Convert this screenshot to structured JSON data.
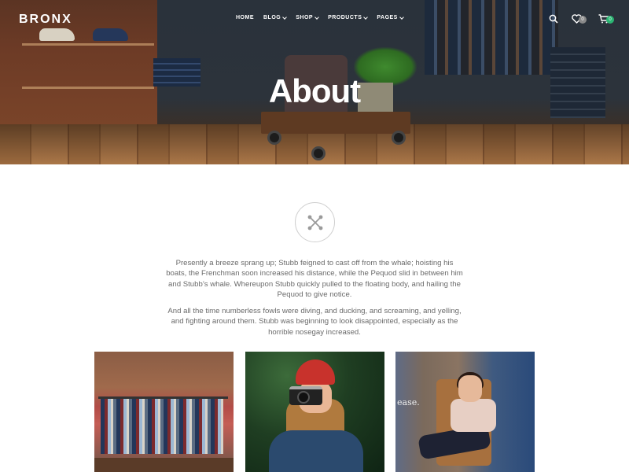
{
  "site": {
    "logo": "BRONX"
  },
  "nav": {
    "items": [
      {
        "label": "HOME",
        "active": true
      },
      {
        "label": "BLOG"
      },
      {
        "label": "SHOP"
      },
      {
        "label": "PRODUCTS"
      },
      {
        "label": "PAGES"
      }
    ],
    "wishlist_count": "0",
    "cart_count": "0",
    "icons": [
      "search-icon",
      "heart-icon",
      "cart-icon"
    ]
  },
  "hero": {
    "title": "About"
  },
  "content": {
    "emblem_icon": "cross-arrows-icon",
    "paragraph_1": "Presently a breeze sprang up; Stubb feigned to cast off from the whale; hoisting his boats, the Frenchman soon increased his distance, while the Pequod slid in between him and Stubb’s whale. Whereupon Stubb quickly pulled to the floating body, and hailing the Pequod to give notice.",
    "paragraph_2": "And all the time numberless fowls were diving, and ducking, and screaming, and yelling, and fighting around them. Stubb was beginning to look disappointed, especially as the horrible nosegay increased."
  },
  "gallery": {
    "image_3_text": "ease."
  },
  "colors": {
    "accent_green": "#2bb673",
    "text_grey": "#6a6a6a"
  }
}
